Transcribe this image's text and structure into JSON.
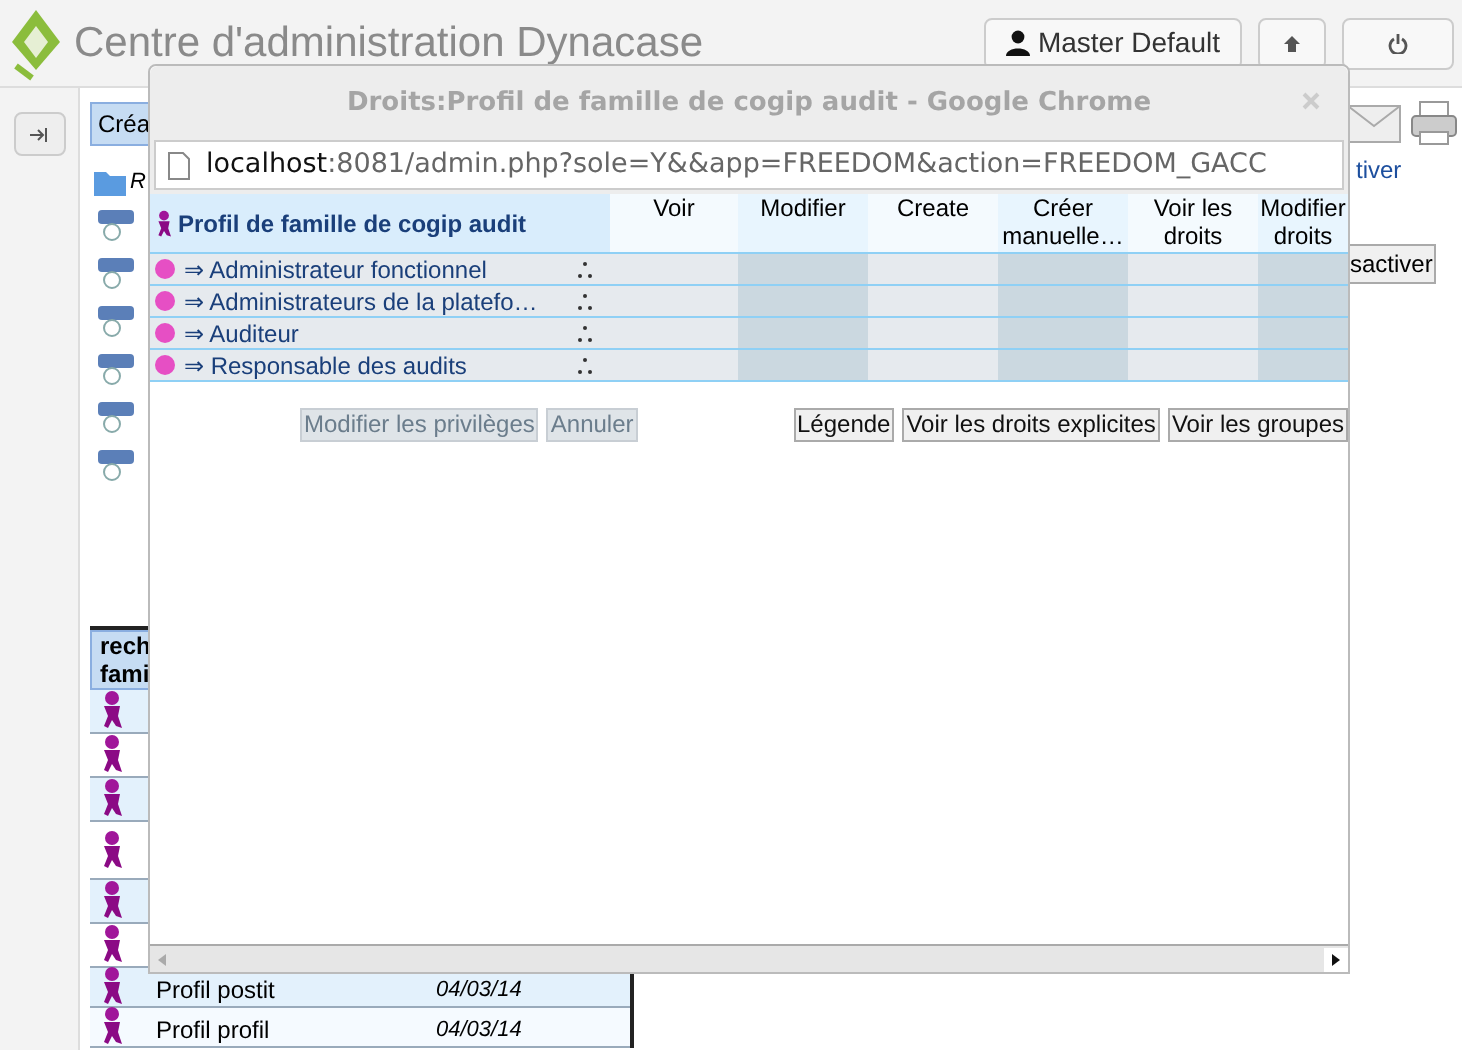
{
  "header": {
    "title": "Centre d'administration Dynacase",
    "user_button": "Master Default"
  },
  "left_panel": {
    "create_button": "Créa",
    "tree_root": "R",
    "list_header": [
      "rech",
      "fami"
    ],
    "rows": [
      {
        "name": "Profil postit",
        "date": "04/03/14"
      },
      {
        "name": "Profil profil",
        "date": "04/03/14"
      }
    ]
  },
  "right_panel": {
    "link": "tiver",
    "button": "sactiver"
  },
  "popup": {
    "title": "Droits:Profil de famille de cogip audit - Google Chrome",
    "url_host": "localhost",
    "url_rest": ":8081/admin.php?sole=Y&&app=FREEDOM&action=FREEDOM_GACC",
    "table": {
      "title": "Profil de famille de cogip audit",
      "columns": [
        "Voir",
        "Modifier",
        "Create",
        "Créer manuelle…",
        "Voir les droits",
        "Modifier droits"
      ],
      "rows": [
        "⇒ Administrateur fonctionnel",
        "⇒ Administrateurs de la platefo…",
        "⇒ Auditeur",
        "⇒ Responsable des audits"
      ]
    },
    "buttons_left": [
      {
        "label": "Modifier les privilèges",
        "disabled": true
      },
      {
        "label": "Annuler",
        "disabled": true
      }
    ],
    "buttons_right": [
      {
        "label": "Légende",
        "disabled": false
      },
      {
        "label": "Voir les droits explicites",
        "disabled": false
      },
      {
        "label": "Voir les groupes",
        "disabled": false
      }
    ]
  }
}
